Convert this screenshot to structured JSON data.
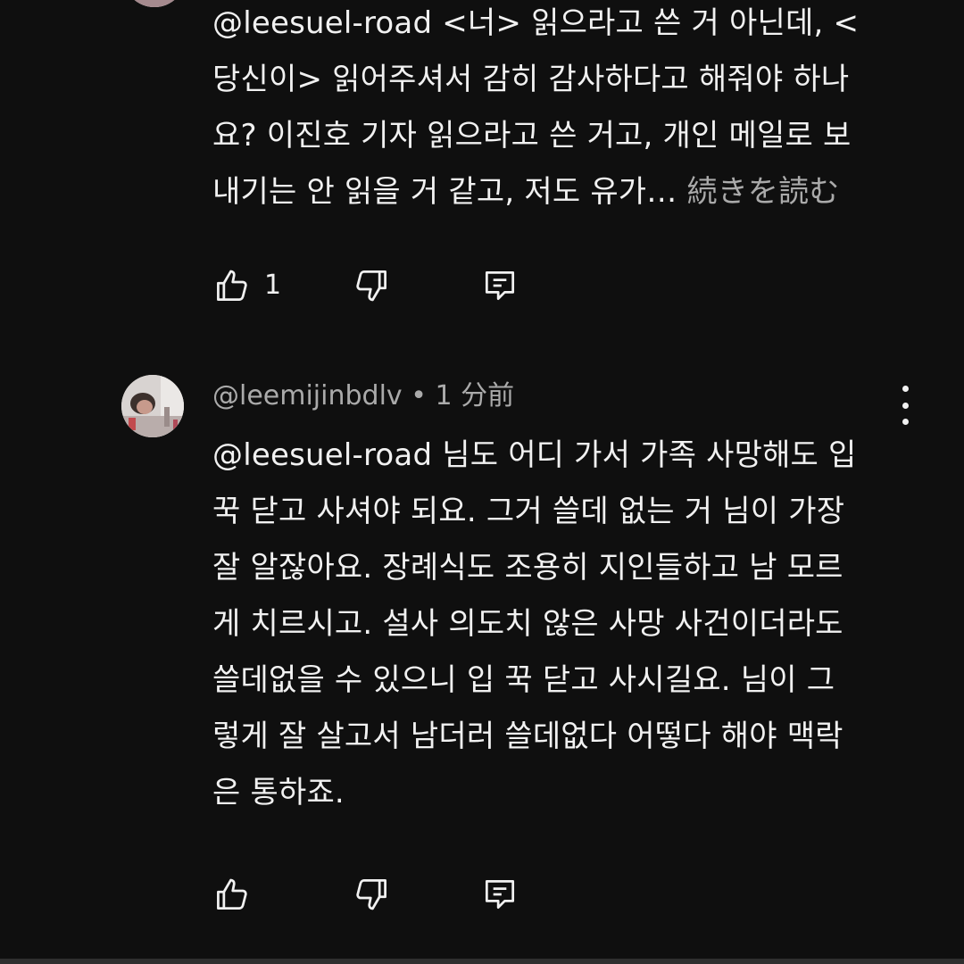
{
  "comments": [
    {
      "body_lines": [
        "@leesuel-road  <너> 읽으라고 쓴 거 아닌데,  <",
        "당신이> 읽어주셔서 감히 감사하다고 해줘야 하나",
        "요? 이진호 기자 읽으라고 쓴 거고, 개인 메일로 보",
        "내기는 안 읽을 거 같고, 저도 유가…"
      ],
      "read_more": " 続きを読む",
      "like_count": "1",
      "like_icon": "thumb-up-icon",
      "dislike_icon": "thumb-down-icon",
      "reply_icon": "reply-comment-icon"
    },
    {
      "author": "@leemijinbdlv",
      "time": "• 1 分前",
      "body_lines": [
        "@leesuel-road  님도 어디 가서 가족 사망해도 입",
        "꾹 닫고 사셔야 되요. 그거 쓸데 없는 거 님이 가장",
        "잘 알잖아요. 장례식도 조용히 지인들하고 남 모르",
        "게 치르시고. 설사 의도치 않은 사망 사건이더라도",
        "쓸데없을 수 있으니 입 꾹 닫고 사시길요. 님이 그",
        "렇게 잘 살고서 남더러 쓸데없다 어떻다 해야 맥락",
        "은 통하죠."
      ],
      "like_icon": "thumb-up-icon",
      "dislike_icon": "thumb-down-icon",
      "reply_icon": "reply-comment-icon",
      "menu_icon": "more-vertical-icon"
    }
  ],
  "colors": {
    "background": "#0f0f0f",
    "text_primary": "#f1f1f1",
    "text_secondary": "#aaaaaa"
  }
}
